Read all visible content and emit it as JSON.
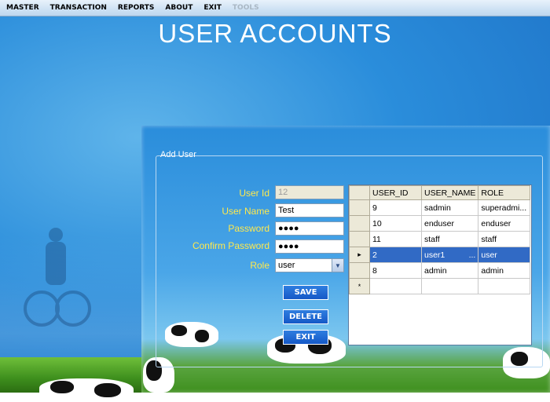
{
  "menu": {
    "items": [
      {
        "label": "MASTER"
      },
      {
        "label": "TRANSACTION"
      },
      {
        "label": "REPORTS"
      },
      {
        "label": "ABOUT"
      },
      {
        "label": "EXIT"
      },
      {
        "label": "TOOLS",
        "disabled": true
      }
    ]
  },
  "page": {
    "title": "USER ACCOUNTS"
  },
  "form": {
    "group_label": "Add User",
    "user_id": {
      "label": "User Id",
      "value": "12"
    },
    "user_name": {
      "label": "User Name",
      "value": "Test"
    },
    "password": {
      "label": "Password",
      "value": "●●●●"
    },
    "confirm_password": {
      "label": "Confirm Password",
      "value": "●●●●"
    },
    "role": {
      "label": "Role",
      "value": "user"
    },
    "buttons": {
      "save": "SAVE",
      "delete": "DELETE",
      "exit": "EXIT"
    }
  },
  "grid": {
    "columns": [
      "USER_ID",
      "USER_NAME",
      "ROLE"
    ],
    "rows": [
      {
        "user_id": "9",
        "user_name": "sadmin",
        "role": "superadmi..."
      },
      {
        "user_id": "10",
        "user_name": "enduser",
        "role": "enduser"
      },
      {
        "user_id": "11",
        "user_name": "staff",
        "role": "staff"
      },
      {
        "user_id": "2",
        "user_name": "user1",
        "role": "user",
        "selected": true,
        "extra": "..."
      },
      {
        "user_id": "8",
        "user_name": "admin",
        "role": "admin"
      }
    ],
    "new_row_marker": "*",
    "current_row_marker": "▸"
  },
  "colors": {
    "label_yellow": "#ffe94d",
    "selection": "#316ac5",
    "button": "#1558c7"
  },
  "icons": {
    "dropdown": "chevron-down-icon"
  }
}
